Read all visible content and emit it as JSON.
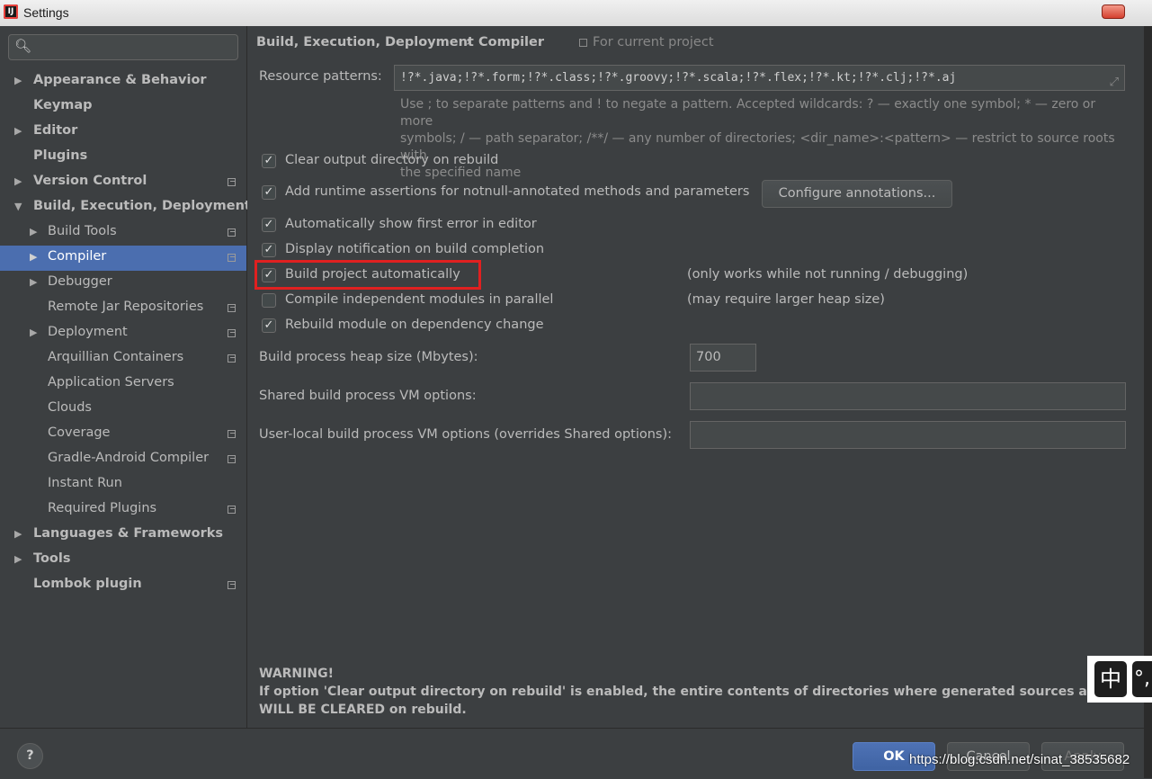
{
  "window": {
    "title": "Settings",
    "app_icon_text": "IJ"
  },
  "sidebar": {
    "search": {
      "placeholder": ""
    },
    "items": [
      {
        "label": "Appearance & Behavior"
      },
      {
        "label": "Keymap"
      },
      {
        "label": "Editor"
      },
      {
        "label": "Plugins"
      },
      {
        "label": "Version Control"
      },
      {
        "label": "Build, Execution, Deployment"
      },
      {
        "label": "Build Tools"
      },
      {
        "label": "Compiler"
      },
      {
        "label": "Debugger"
      },
      {
        "label": "Remote Jar Repositories"
      },
      {
        "label": "Deployment"
      },
      {
        "label": "Arquillian Containers"
      },
      {
        "label": "Application Servers"
      },
      {
        "label": "Clouds"
      },
      {
        "label": "Coverage"
      },
      {
        "label": "Gradle-Android Compiler"
      },
      {
        "label": "Instant Run"
      },
      {
        "label": "Required Plugins"
      },
      {
        "label": "Languages & Frameworks"
      },
      {
        "label": "Tools"
      },
      {
        "label": "Lombok plugin"
      }
    ]
  },
  "breadcrumb": {
    "parent": "Build, Execution, Deployment",
    "separator": "›",
    "current": "Compiler",
    "scope": "For current project"
  },
  "resource_patterns": {
    "label": "Resource patterns:",
    "value": "!?*.java;!?*.form;!?*.class;!?*.groovy;!?*.scala;!?*.flex;!?*.kt;!?*.clj;!?*.aj",
    "hint_line1": "Use ; to separate patterns and ! to negate a pattern. Accepted wildcards: ? — exactly one symbol; * — zero or more",
    "hint_line2": "symbols; / — path separator; /**/ — any number of directories;  <dir_name>:<pattern> — restrict to source roots with",
    "hint_line3": "the specified name"
  },
  "options": [
    {
      "label": "Clear output directory on rebuild",
      "checked": true
    },
    {
      "label": "Add runtime assertions for notnull-annotated methods and parameters",
      "checked": true
    },
    {
      "label": "Automatically show first error in editor",
      "checked": true
    },
    {
      "label": "Display notification on build completion",
      "checked": true
    },
    {
      "label": "Build project automatically",
      "checked": true,
      "note": "(only works while not running / debugging)"
    },
    {
      "label": "Compile independent modules in parallel",
      "checked": false,
      "note": "(may require larger heap size)"
    },
    {
      "label": "Rebuild module on dependency change",
      "checked": true
    }
  ],
  "check_glyph": "✓",
  "configure_button": "Configure annotations...",
  "heap": {
    "label": "Build process heap size (Mbytes):",
    "value": "700"
  },
  "shared_vm": {
    "label": "Shared build process VM options:",
    "value": ""
  },
  "user_vm": {
    "label": "User-local build process VM options (overrides Shared options):",
    "value": ""
  },
  "warning": {
    "title": "WARNING!",
    "line1": "If option 'Clear output directory on rebuild' is enabled, the entire contents of directories where generated sources are stored",
    "line2": "WILL BE CLEARED on rebuild."
  },
  "footer": {
    "help": "?",
    "ok": "OK",
    "cancel": "Cancel",
    "apply": "Apply"
  },
  "ime": {
    "key1": "中",
    "key2": "°,"
  },
  "watermark": "https://blog.csdn.net/sinat_38535682",
  "colors": {
    "selection": "#4b6eaf",
    "highlight_box": "#e02020",
    "background": "#3c3f41"
  }
}
